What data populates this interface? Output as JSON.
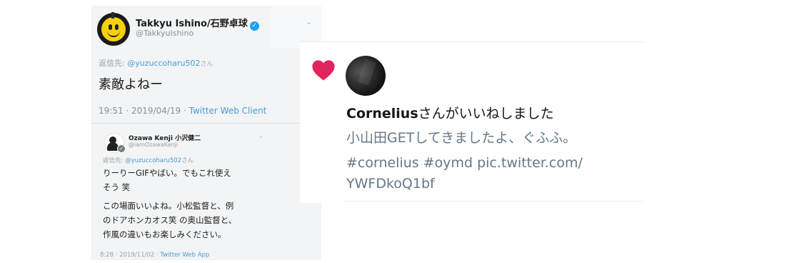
{
  "left_tweet": {
    "display_name": "Takkyu Ishino/石野卓球",
    "handle": "@TakkyuIshino",
    "reply_label": "返信先:",
    "reply_target": "@yuzuccoharu502",
    "reply_suffix": "さん",
    "body": "素敵よねー",
    "time": "19:51 · 2019/04/19 · ",
    "client": "Twitter Web Client",
    "quoted": {
      "display_name": "Ozawa Kenji 小沢健二",
      "handle": "@iamOzawaKenji",
      "reply_label": "返信先:",
      "reply_target": "@yuzuccoharu502",
      "reply_suffix": "さん",
      "lines": [
        "りーりーGIFやばい。でもこれ使え",
        "そう 笑",
        "この場面いいよね。小松監督と、例",
        "のドアホンカオス笑 の奥山監督と、",
        "作風の違いもお楽しみください。"
      ],
      "time": "8:28 · 2019/11/02 · ",
      "client": "Twitter Web App"
    }
  },
  "notification": {
    "user": "Cornelius",
    "action": "さんがいいねしました",
    "text": "小山田GETしてきましたよ、ぐふふ。",
    "tag_lines": [
      "#cornelius #oymd pic.twitter.com/",
      "YWFDkoQ1bf"
    ]
  },
  "colors": {
    "heart": "#e0245e",
    "link": "#4a9bd6",
    "muted": "#657786",
    "verified": "#1da1f2"
  },
  "icons": {
    "verified": "verified-badge-icon",
    "like": "heart-icon",
    "menu": "chevron-down-icon"
  }
}
